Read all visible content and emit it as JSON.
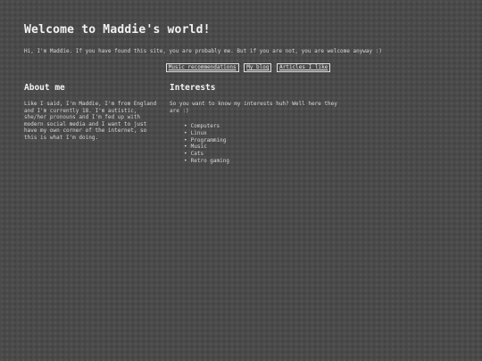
{
  "header": {
    "title": "Welcome to Maddie's world!",
    "intro": "Hi, I'm Maddie. If you have found this site, you are probably me. But if you are not, you are welcome anyway :)"
  },
  "nav": {
    "links": [
      {
        "label": "Music recommendations"
      },
      {
        "label": "My blog"
      },
      {
        "label": "Articles I like"
      }
    ]
  },
  "about": {
    "heading": "About me",
    "text": "Like I said, I'm Maddie, I'm from England and I'm currently 18. I'm autistic, she/her pronouns and I'm fed up with modern social media and I want to just have my own corner of the internet, so this is what I'm doing."
  },
  "interests": {
    "heading": "Interests",
    "intro": "So you want to know my interests huh? Well here they are :)",
    "items": [
      "Computers",
      "Linux",
      "Programming",
      "Music",
      "Cats",
      "Retro gaming"
    ]
  }
}
